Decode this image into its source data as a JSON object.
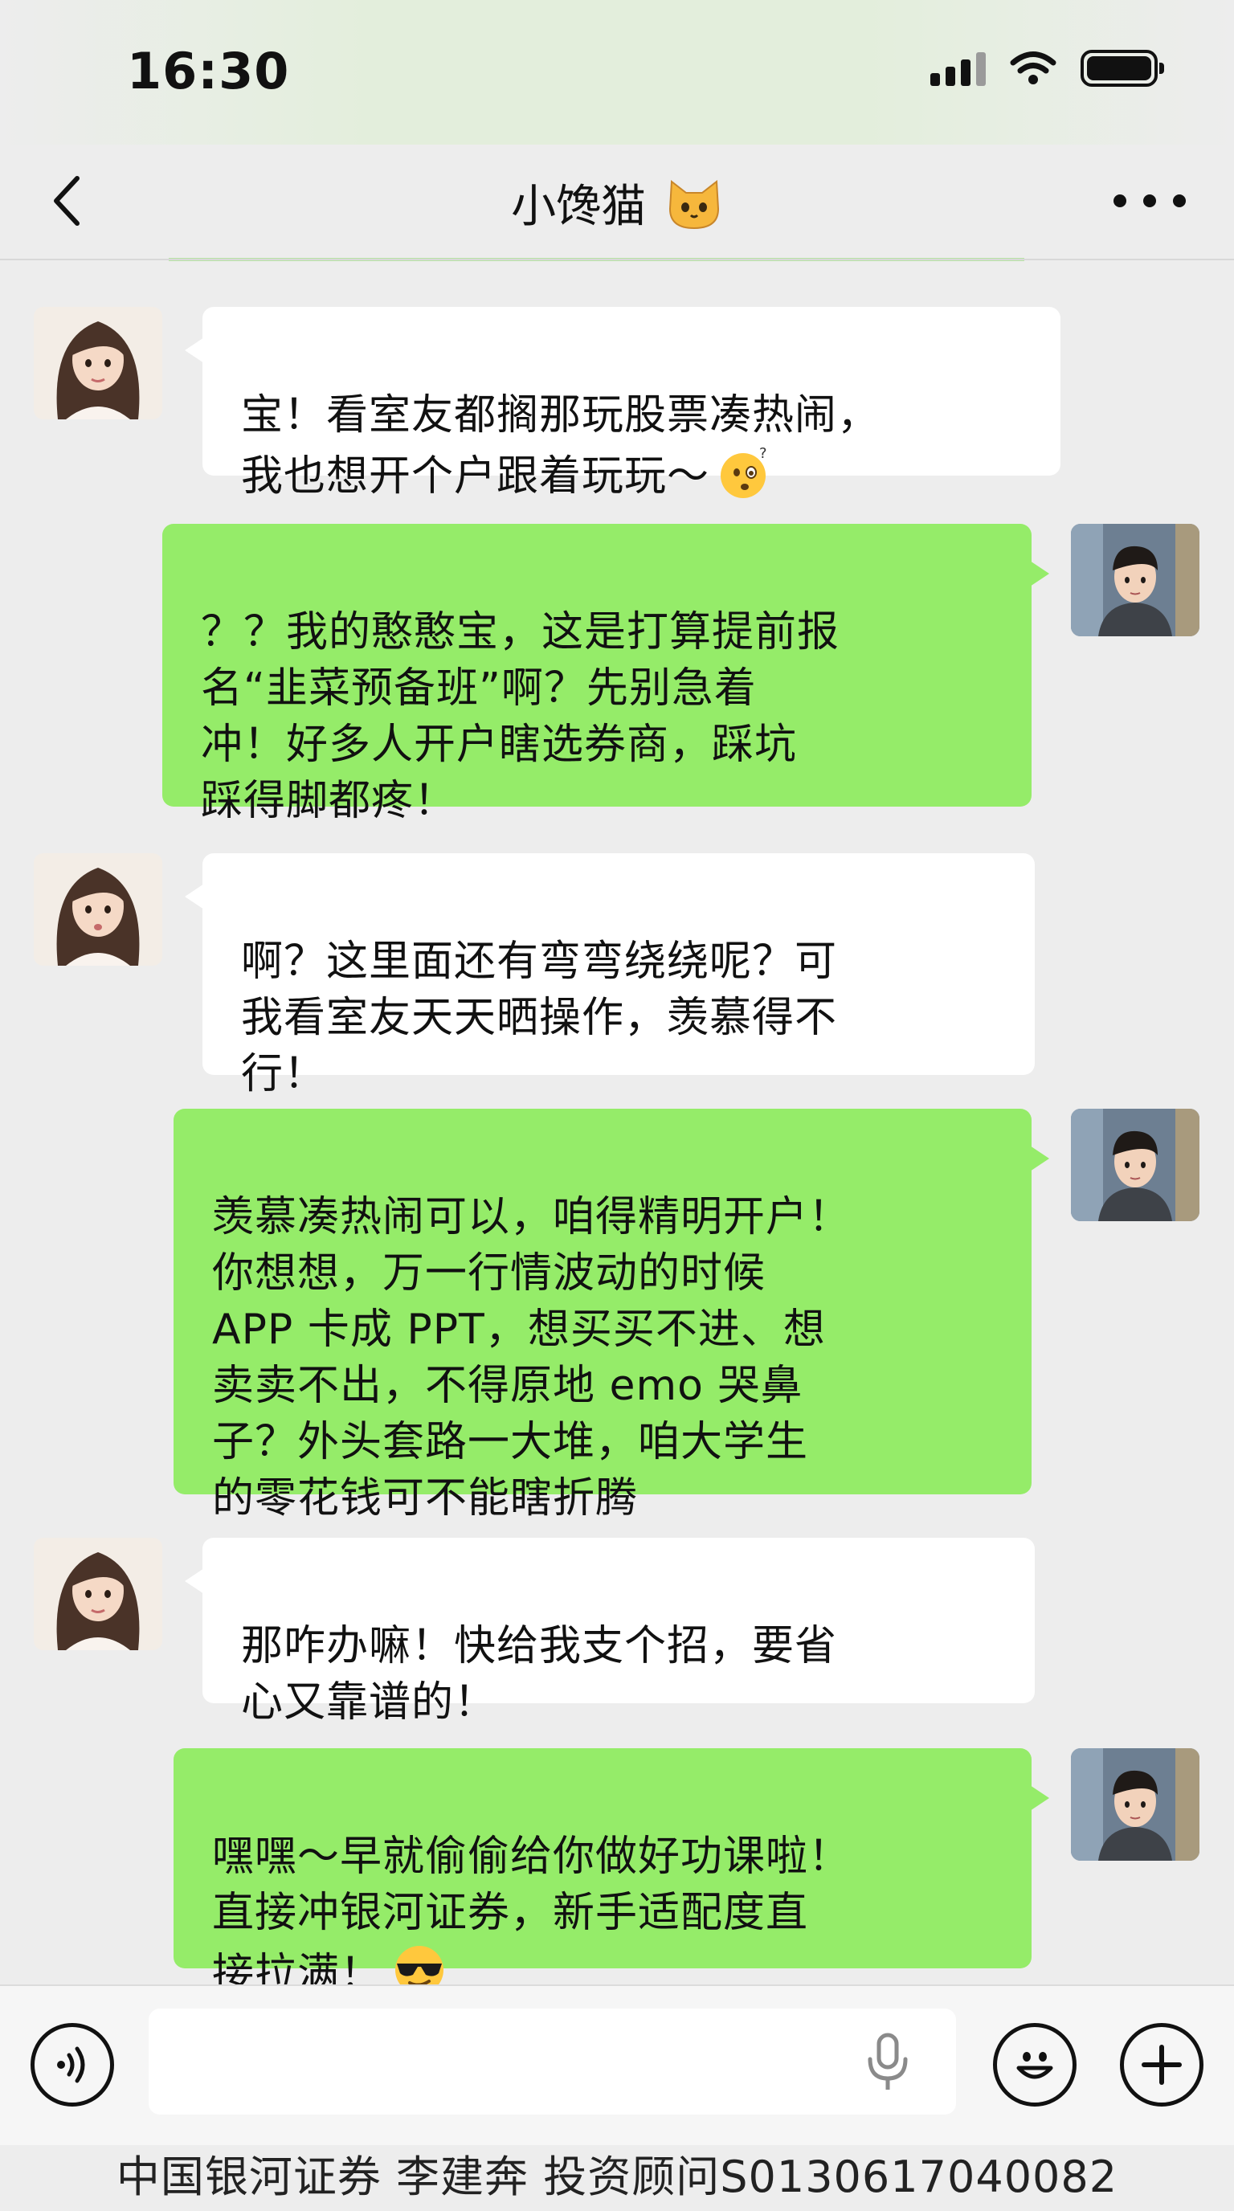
{
  "status_bar": {
    "time": "16:30"
  },
  "nav": {
    "title": "小馋猫",
    "title_emoji": "cat-face-icon"
  },
  "messages": [
    {
      "sender": "her",
      "text": "宝！看室友都搁那玩股票凑热闹，\n我也想开个户跟着玩玩～",
      "emoji": "thinking-face-icon"
    },
    {
      "sender": "me",
      "text": "？？我的憨憨宝，这是打算提前报\n名“韭菜预备班”啊？先别急着\n冲！好多人开户瞎选券商，踩坑\n踩得脚都疼！"
    },
    {
      "sender": "her",
      "text": "啊？这里面还有弯弯绕绕呢？可\n我看室友天天晒操作，羡慕得不\n行！"
    },
    {
      "sender": "me",
      "text": "羡慕凑热闹可以，咱得精明开户！\n你想想，万一行情波动的时候\nAPP 卡成 PPT，想买买不进、想\n卖卖不出，不得原地 emo 哭鼻\n子？外头套路一大堆，咱大学生\n的零花钱可不能瞎折腾"
    },
    {
      "sender": "her",
      "text": "那咋办嘛！快给我支个招，要省\n心又靠谱的！"
    },
    {
      "sender": "me",
      "text": "嘿嘿～早就偷偷给你做好功课啦！\n直接冲银河证券，新手适配度直\n接拉满！",
      "emoji": "sunglasses-face-icon"
    }
  ],
  "input_bar": {
    "voice_icon": "voice-mode-icon",
    "mic_icon": "microphone-icon",
    "emoji_icon": "emoji-smile-icon",
    "plus_icon": "plus-icon"
  },
  "footer_note": "中国银河证券 李建奔 投资顾问S0130617040082",
  "colors": {
    "bubble_green": "#95ec69",
    "bubble_white": "#ffffff",
    "background": "#ededed"
  }
}
